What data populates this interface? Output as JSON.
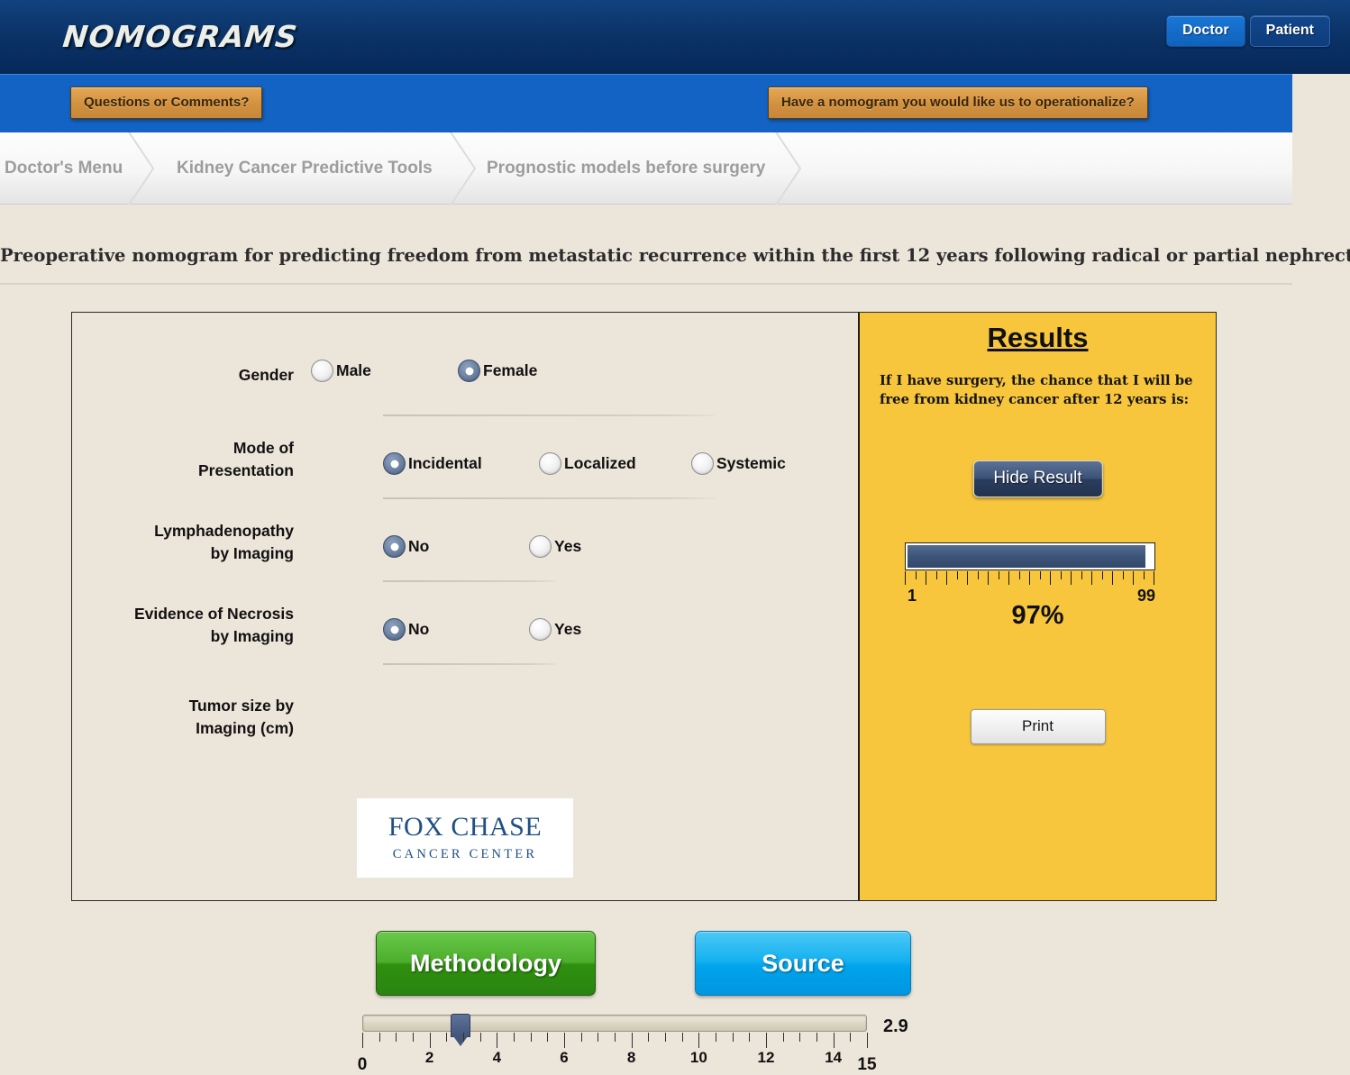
{
  "header": {
    "logo_text": "NOMOGRAMS",
    "audience_buttons": [
      {
        "label": "Doctor",
        "state": "active"
      },
      {
        "label": "Patient",
        "state": "inactive"
      }
    ]
  },
  "action_bar": {
    "questions_label": "Questions or Comments?",
    "operationalize_label": "Have a nomogram you would like us to operationalize?"
  },
  "breadcrumb": {
    "items": [
      {
        "label": "Doctor's Menu"
      },
      {
        "label": "Kidney Cancer Predictive Tools"
      },
      {
        "label": "Prognostic models before surgery"
      }
    ]
  },
  "page": {
    "title": "Preoperative nomogram for predicting freedom from metastatic recurrence within the first 12 years following radical or partial nephrectomy"
  },
  "form": {
    "rows": [
      {
        "label": "Gender",
        "options": [
          {
            "label": "Male",
            "selected": false
          },
          {
            "label": "Female",
            "selected": true
          }
        ]
      },
      {
        "label": "Mode of Presentation",
        "label_line1": "Mode of",
        "label_line2": "Presentation",
        "options": [
          {
            "label": "Incidental",
            "selected": true
          },
          {
            "label": "Localized",
            "selected": false
          },
          {
            "label": "Systemic",
            "selected": false
          }
        ]
      },
      {
        "label": "Lymphadenopathy by Imaging",
        "label_line1": "Lymphadenopathy",
        "label_line2": "by Imaging",
        "options": [
          {
            "label": "No",
            "selected": true
          },
          {
            "label": "Yes",
            "selected": false
          }
        ]
      },
      {
        "label": "Evidence of Necrosis by Imaging",
        "label_line1": "Evidence of Necrosis",
        "label_line2": "by Imaging",
        "options": [
          {
            "label": "No",
            "selected": true
          },
          {
            "label": "Yes",
            "selected": false
          }
        ]
      }
    ],
    "slider": {
      "label_line1": "Tumor size by",
      "label_line2": "Imaging (cm)",
      "value": "2.9",
      "min": 0,
      "max": 15,
      "tick_labels": [
        "0",
        "2",
        "4",
        "6",
        "8",
        "10",
        "12",
        "14",
        "15"
      ],
      "tick_values": [
        0,
        2,
        4,
        6,
        8,
        10,
        12,
        14,
        15
      ],
      "minor_tick_step": 0.5
    },
    "logo": {
      "line1": "FOX CHASE",
      "line2": "CANCER CENTER"
    }
  },
  "results": {
    "title": "Results",
    "statement": "If I have surgery, the chance that I will be free from kidney cancer after 12 years is:",
    "hide_button_label": "Hide Result",
    "gauge": {
      "min_label": "1",
      "max_label": "99",
      "fill_percent": 97
    },
    "percent_label": "97%",
    "print_button_label": "Print"
  },
  "footer": {
    "methodology_label": "Methodology",
    "source_label": "Source"
  },
  "colors": {
    "header_navy": "#0b3266",
    "action_blue": "#1263c4",
    "gold_button": "#d2913f",
    "results_yellow": "#f8c63d",
    "page_background": "#ece5da",
    "methodology_green": "#4cae2c",
    "source_blue": "#00a4ec",
    "gauge_fill": "#3d5578"
  }
}
